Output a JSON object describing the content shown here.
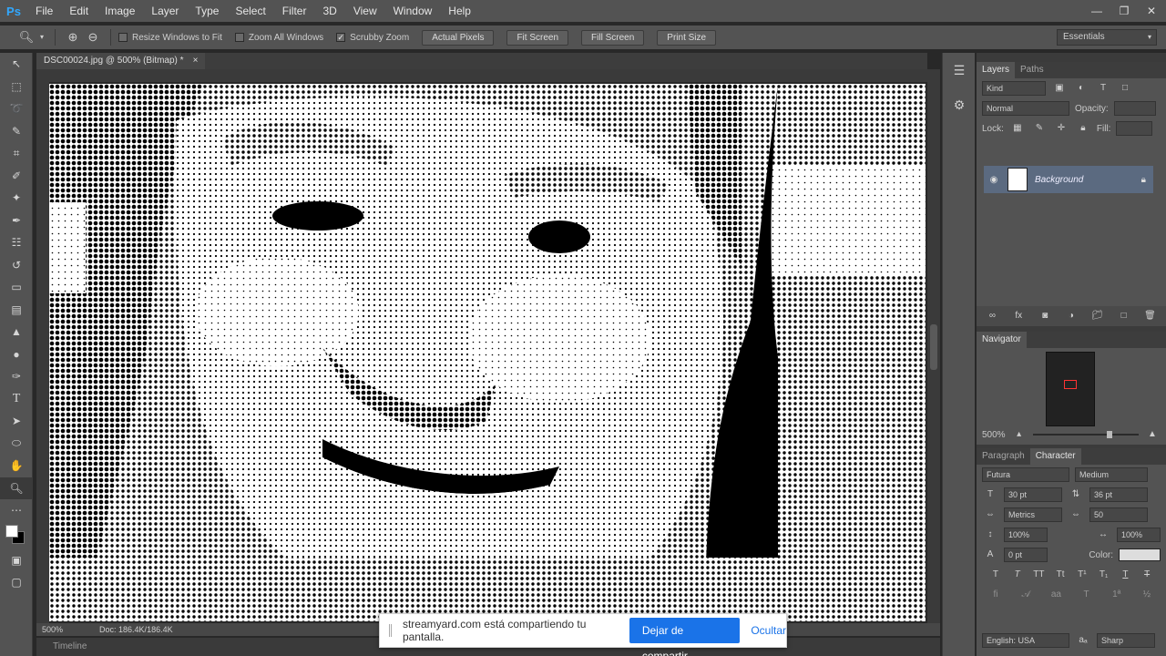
{
  "app": {
    "logo": "Ps"
  },
  "menu": [
    "File",
    "Edit",
    "Image",
    "Layer",
    "Type",
    "Select",
    "Filter",
    "3D",
    "View",
    "Window",
    "Help"
  ],
  "options": {
    "resize_windows": {
      "label": "Resize Windows to Fit",
      "checked": false
    },
    "zoom_all": {
      "label": "Zoom All Windows",
      "checked": false
    },
    "scrubby": {
      "label": "Scrubby Zoom",
      "checked": true
    },
    "buttons": [
      "Actual Pixels",
      "Fit Screen",
      "Fill Screen",
      "Print Size"
    ],
    "workspace": "Essentials"
  },
  "document": {
    "tab_title": "DSC00024.jpg @ 500% (Bitmap) *",
    "close": "×"
  },
  "status": {
    "zoom": "500%",
    "doc": "Doc: 186.4K/186.4K"
  },
  "timeline": {
    "label": "Timeline"
  },
  "layers_panel": {
    "tabs": [
      "Layers",
      "Paths"
    ],
    "kind": "Kind",
    "blend": "Normal",
    "opacity_label": "Opacity:",
    "lock_label": "Lock:",
    "fill_label": "Fill:",
    "layer_name": "Background"
  },
  "navigator": {
    "title": "Navigator",
    "zoom": "500%"
  },
  "character": {
    "tabs": [
      "Paragraph",
      "Character"
    ],
    "font_family": "Futura",
    "font_style": "Medium",
    "size": "30 pt",
    "leading": "36 pt",
    "kerning": "Metrics",
    "tracking": "50",
    "vscale": "100%",
    "hscale": "100%",
    "baseline": "0 pt",
    "color_label": "Color:",
    "language": "English: USA",
    "aa": "Sharp"
  },
  "share_banner": {
    "text": "streamyard.com está compartiendo tu pantalla.",
    "stop": "Dejar de compartir",
    "hide": "Ocultar"
  },
  "colors": {
    "menubar": "#535353",
    "selected_layer": "#5b6a80",
    "share_button": "#1a73e8"
  }
}
